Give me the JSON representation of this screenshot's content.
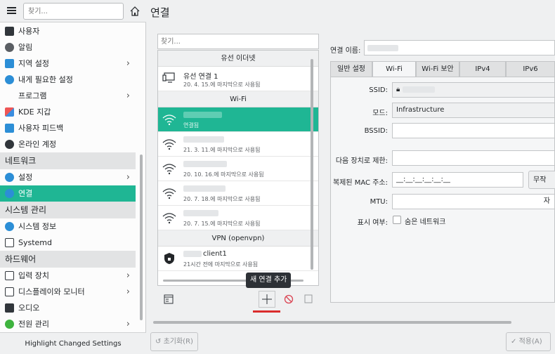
{
  "sidebar": {
    "search_placeholder": "찾기...",
    "items": [
      {
        "label": "사용자",
        "icon": "user-icon",
        "has_child": false
      },
      {
        "label": "알림",
        "icon": "bell-icon",
        "has_child": false
      },
      {
        "label": "지역 설정",
        "icon": "region-icon",
        "has_child": true
      },
      {
        "label": "내게 필요한 설정",
        "icon": "accessibility-icon",
        "has_child": false
      },
      {
        "label": "프로그램",
        "icon": "",
        "has_child": true
      },
      {
        "label": "KDE 지갑",
        "icon": "wallet-icon",
        "has_child": false
      },
      {
        "label": "사용자 피드백",
        "icon": "feedback-icon",
        "has_child": false
      },
      {
        "label": "온라인 계정",
        "icon": "online-accounts-icon",
        "has_child": false
      }
    ],
    "cat_network": "네트워크",
    "net_items": [
      {
        "label": "설정",
        "icon": "network-settings-icon",
        "has_child": true
      },
      {
        "label": "연결",
        "icon": "connections-icon",
        "has_child": false
      }
    ],
    "cat_system": "시스템 관리",
    "sys_items": [
      {
        "label": "시스템 정보",
        "icon": "info-icon",
        "has_child": false
      },
      {
        "label": "Systemd",
        "icon": "systemd-icon",
        "has_child": false
      }
    ],
    "cat_hardware": "하드웨어",
    "hw_items": [
      {
        "label": "입력 장치",
        "icon": "keyboard-icon",
        "has_child": true
      },
      {
        "label": "디스플레이와 모니터",
        "icon": "display-icon",
        "has_child": true
      },
      {
        "label": "오디오",
        "icon": "audio-icon",
        "has_child": false
      },
      {
        "label": "전원 관리",
        "icon": "power-icon",
        "has_child": true
      }
    ],
    "highlight_label": "Highlight Changed Settings"
  },
  "header": {
    "title": "연결"
  },
  "connections": {
    "search_placeholder": "찾기...",
    "group_wired": "유선 이더넷",
    "wired": [
      {
        "name": "유선 연결 1",
        "sub": "20. 4. 15.에 마지막으로 사용됨"
      }
    ],
    "group_wifi": "Wi-Fi",
    "wifi": [
      {
        "name": "",
        "sub": "연결됨",
        "active": true
      },
      {
        "name": "",
        "sub": "21. 3. 11.에 마지막으로 사용됨"
      },
      {
        "name": "",
        "sub": "20. 10. 16.에 마지막으로 사용됨"
      },
      {
        "name": "",
        "sub": "20. 7. 18.에 마지막으로 사용됨"
      },
      {
        "name": "",
        "sub": "20. 7. 15.에 마지막으로 사용됨"
      }
    ],
    "group_vpn": "VPN (openvpn)",
    "vpn": [
      {
        "name": "client1",
        "sub": "21시간 전에 마지막으로 사용됨"
      }
    ],
    "tooltip": "새 연결 추가"
  },
  "form": {
    "name_label": "연결 이름:",
    "tabs": [
      "일반 설정",
      "Wi-Fi",
      "Wi-Fi 보안",
      "IPv4",
      "IPv6"
    ],
    "active_tab": 1,
    "ssid_label": "SSID:",
    "mode_label": "모드:",
    "mode_value": "Infrastructure",
    "bssid_label": "BSSID:",
    "restrict_label": "다음 장치로 제한:",
    "mac_label": "복제된 MAC 주소:",
    "mac_placeholder": "__:__:__:__:__:__",
    "random_button": "무작",
    "mtu_label": "MTU:",
    "mtu_suffix": "자",
    "visibility_label": "표시 여부:",
    "hidden_network": "숨은 네트워크"
  },
  "footer": {
    "reset": "초기화(R)",
    "apply": "적용(A)"
  },
  "colors": {
    "accent": "#1fb694",
    "underline": "#da2d2d"
  }
}
